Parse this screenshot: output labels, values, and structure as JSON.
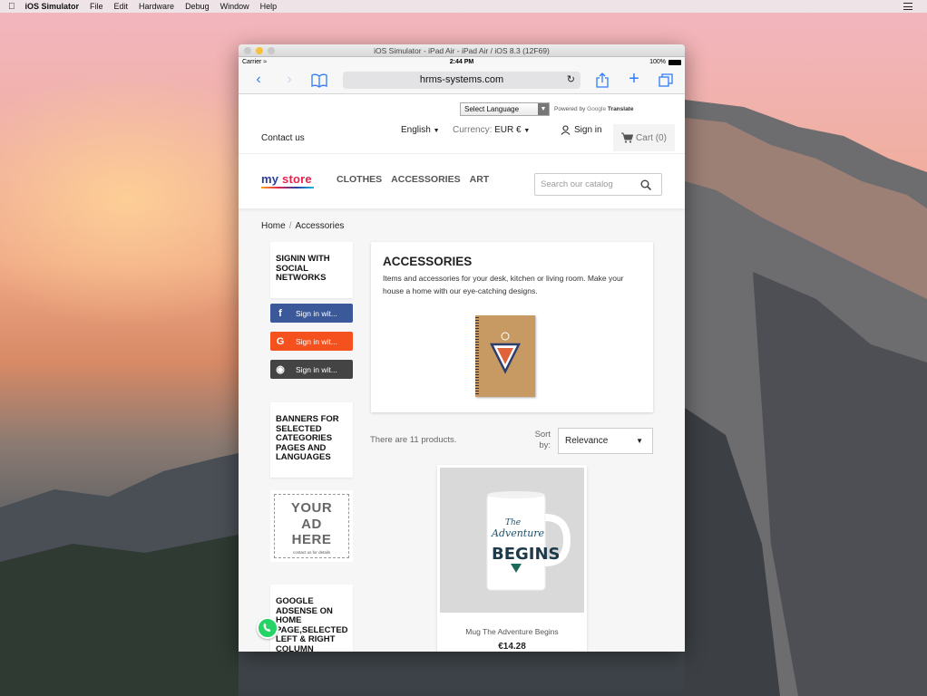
{
  "menubar": {
    "app_name": "iOS Simulator",
    "items": [
      "File",
      "Edit",
      "Hardware",
      "Debug",
      "Window",
      "Help"
    ]
  },
  "window": {
    "title": "iOS Simulator - iPad Air - iPad Air / iOS 8.3 (12F69)"
  },
  "statusbar": {
    "carrier": "Carrier",
    "time": "2:44 PM",
    "battery": "100%"
  },
  "safari": {
    "url": "hrms-systems.com"
  },
  "site": {
    "translate": {
      "select_label": "Select Language",
      "powered_by": "Powered by",
      "google": "Google",
      "translate_word": "Translate"
    },
    "contact": "Contact us",
    "language": "English",
    "currency_label": "Currency:",
    "currency_value": "EUR €",
    "signin": "Sign in",
    "cart": "Cart (0)",
    "logo_part1": "my",
    "logo_part2": "store",
    "menu": [
      "CLOTHES",
      "ACCESSORIES",
      "ART"
    ],
    "search_placeholder": "Search our catalog",
    "breadcrumb": [
      "Home",
      "Accessories"
    ]
  },
  "sidebar": {
    "social_title": "SIGNIN WITH SOCIAL NETWORKS",
    "social_buttons": [
      "Sign in wit...",
      "Sign in wit...",
      "Sign in wit..."
    ],
    "banners_title": "BANNERS FOR SELECTED CATEGORIES PAGES AND LANGUAGES",
    "ad_text_1": "YOUR",
    "ad_text_2": "AD",
    "ad_text_3": "HERE",
    "ad_sub": "contact us for details",
    "adsense_title": "GOOGLE ADSENSE ON HOME PAGE,SELECTED LEFT & RIGHT COLUMN"
  },
  "category": {
    "title": "ACCESSORIES",
    "description": "Items and accessories for your desk, kitchen or living room. Make your house a home with our eye-catching designs."
  },
  "listing": {
    "count_text": "There are 11 products.",
    "sort_label": "Sort by:",
    "sort_value": "Relevance"
  },
  "product": {
    "name": "Mug The Adventure Begins",
    "price": "€14.28",
    "mug_text_1": "The",
    "mug_text_2": "Adventure",
    "mug_text_3": "BEGINS"
  }
}
